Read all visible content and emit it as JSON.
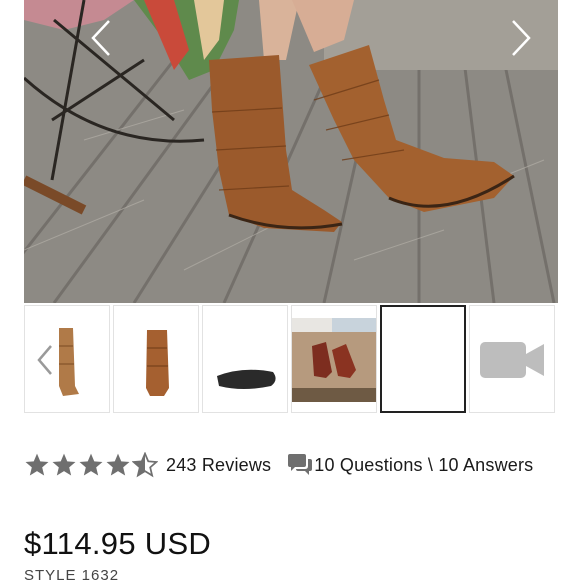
{
  "product": {
    "rating": {
      "stars_filled": 4.5,
      "stars_total": 5,
      "reviews_label": "243 Reviews"
    },
    "qa_label": "10 Questions \\ 10 Answers",
    "price": "$114.95 USD",
    "style": "STYLE 1632"
  },
  "gallery": {
    "thumbnails": [
      {
        "kind": "boot-side-view"
      },
      {
        "kind": "boot-front-view"
      },
      {
        "kind": "boot-sole-view"
      },
      {
        "kind": "lifestyle-photo"
      },
      {
        "kind": "blank",
        "selected": true
      },
      {
        "kind": "video-icon"
      }
    ]
  },
  "colors": {
    "suede": "#9b5a2c",
    "star": "#6f6f6f",
    "text": "#1a1a1a"
  },
  "icons": [
    "chevron-left-icon",
    "chevron-right-icon",
    "star-icon",
    "chat-bubbles-icon",
    "video-camera-icon"
  ]
}
